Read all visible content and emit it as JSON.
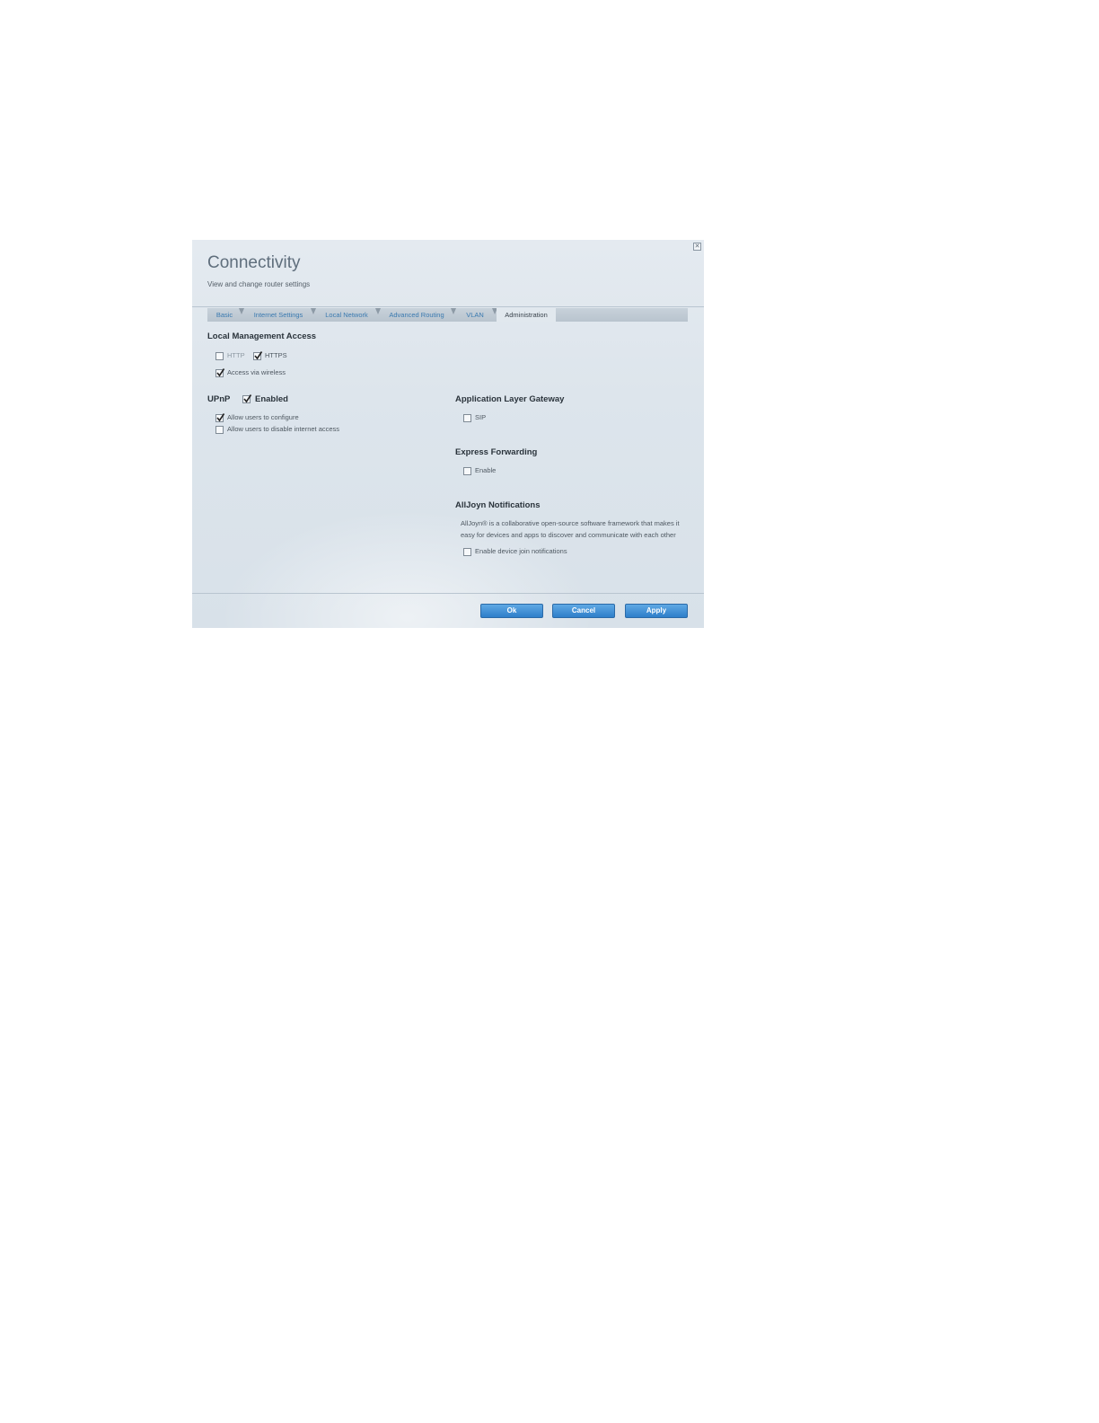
{
  "dialog": {
    "title": "Connectivity",
    "subtitle": "View and change router settings",
    "close_icon": "close-icon"
  },
  "tabs": [
    {
      "label": "Basic",
      "active": false
    },
    {
      "label": "Internet Settings",
      "active": false
    },
    {
      "label": "Local Network",
      "active": false
    },
    {
      "label": "Advanced Routing",
      "active": false
    },
    {
      "label": "VLAN",
      "active": false
    },
    {
      "label": "Administration",
      "active": true
    }
  ],
  "local_management": {
    "title": "Local Management Access",
    "http": {
      "label": "HTTP",
      "checked": false
    },
    "https": {
      "label": "HTTPS",
      "checked": true
    },
    "wireless": {
      "label": "Access via wireless",
      "checked": true
    }
  },
  "upnp": {
    "title": "UPnP",
    "enabled": {
      "label": "Enabled",
      "checked": true
    },
    "allow_configure": {
      "label": "Allow users to configure",
      "checked": true
    },
    "allow_disable": {
      "label": "Allow users to disable internet access",
      "checked": false
    }
  },
  "alg": {
    "title": "Application Layer Gateway",
    "sip": {
      "label": "SIP",
      "checked": false
    }
  },
  "express_forwarding": {
    "title": "Express Forwarding",
    "enable": {
      "label": "Enable",
      "checked": false
    }
  },
  "alljoyn": {
    "title": "AllJoyn Notifications",
    "description": "AllJoyn® is a collaborative open-source software framework that makes it easy for devices and apps to discover and communicate with each other",
    "enable": {
      "label": "Enable device join notifications",
      "checked": false
    }
  },
  "buttons": {
    "ok": "Ok",
    "cancel": "Cancel",
    "apply": "Apply"
  },
  "colors": {
    "button_blue": "#2e7ec9",
    "tab_link": "#3a7ab0"
  }
}
